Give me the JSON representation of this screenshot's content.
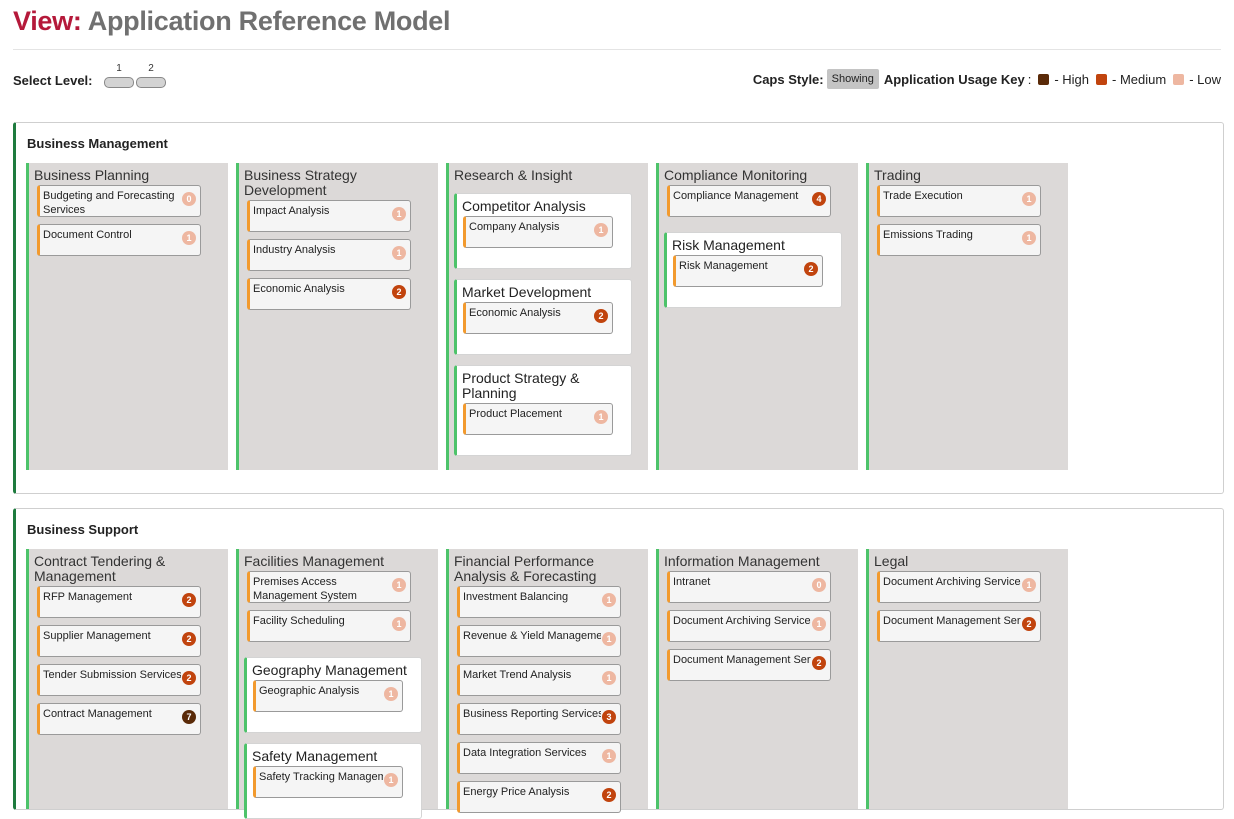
{
  "header": {
    "view_label": "View:",
    "title": "Application Reference Model"
  },
  "controls": {
    "select_level_label": "Select Level:",
    "levels": [
      "1",
      "2"
    ],
    "caps_style_label": "Caps Style:",
    "caps_style_value": "Showing",
    "usage_key_label": "Application Usage Key",
    "key": [
      {
        "label": "- High",
        "color": "#5a2a08"
      },
      {
        "label": "- Medium",
        "color": "#c1440e"
      },
      {
        "label": "- Low",
        "color": "#eeb7a1"
      }
    ]
  },
  "sections": [
    {
      "title": "Business Management",
      "columns": [
        {
          "title": "Business Planning",
          "apps": [
            {
              "name": "Budgeting and Forecasting Services",
              "count": "0"
            },
            {
              "name": "Document Control",
              "count": "1"
            }
          ]
        },
        {
          "title": "Business Strategy Development",
          "apps": [
            {
              "name": "Impact Analysis",
              "count": "1"
            },
            {
              "name": "Industry Analysis",
              "count": "1"
            },
            {
              "name": "Economic Analysis",
              "count": "2"
            }
          ]
        },
        {
          "title": "Research & Insight",
          "subs": [
            {
              "title": "Competitor Analysis",
              "apps": [
                {
                  "name": "Company Analysis",
                  "count": "1"
                }
              ]
            },
            {
              "title": "Market Development",
              "apps": [
                {
                  "name": "Economic Analysis",
                  "count": "2"
                }
              ]
            },
            {
              "title": "Product Strategy & Planning",
              "apps": [
                {
                  "name": "Product Placement",
                  "count": "1"
                }
              ]
            }
          ]
        },
        {
          "title": "Compliance Monitoring",
          "apps": [
            {
              "name": "Compliance Management",
              "count": "4"
            }
          ],
          "subs": [
            {
              "title": "Risk Management",
              "apps": [
                {
                  "name": "Risk Management",
                  "count": "2"
                }
              ]
            }
          ]
        },
        {
          "title": "Trading",
          "apps": [
            {
              "name": "Trade Execution",
              "count": "1"
            },
            {
              "name": "Emissions Trading",
              "count": "1"
            }
          ]
        }
      ]
    },
    {
      "title": "Business Support",
      "columns": [
        {
          "title": "Contract Tendering & Management",
          "apps": [
            {
              "name": "RFP Management",
              "count": "2"
            },
            {
              "name": "Supplier Management",
              "count": "2"
            },
            {
              "name": "Tender Submission Services",
              "count": "2"
            },
            {
              "name": "Contract Management",
              "count": "7"
            }
          ]
        },
        {
          "title": "Facilities Management",
          "apps": [
            {
              "name": "Premises Access Management System",
              "count": "1"
            },
            {
              "name": "Facility Scheduling",
              "count": "1"
            }
          ],
          "subs": [
            {
              "title": "Geography Management",
              "apps": [
                {
                  "name": "Geographic Analysis",
                  "count": "1"
                }
              ]
            },
            {
              "title": "Safety Management",
              "apps": [
                {
                  "name": "Safety Tracking Management",
                  "count": "1"
                }
              ]
            }
          ]
        },
        {
          "title": "Financial Performance Analysis & Forecasting",
          "apps": [
            {
              "name": "Investment Balancing",
              "count": "1"
            },
            {
              "name": "Revenue & Yield Management",
              "count": "1"
            },
            {
              "name": "Market Trend Analysis",
              "count": "1"
            },
            {
              "name": "Business Reporting Services",
              "count": "3"
            },
            {
              "name": "Data Integration Services",
              "count": "1"
            },
            {
              "name": "Energy Price Analysis",
              "count": "2"
            }
          ]
        },
        {
          "title": "Information Management",
          "apps": [
            {
              "name": "Intranet",
              "count": "0"
            },
            {
              "name": "Document Archiving Services",
              "count": "1"
            },
            {
              "name": "Document Management Services",
              "count": "2"
            }
          ]
        },
        {
          "title": "Legal",
          "apps": [
            {
              "name": "Document Archiving Services",
              "count": "1"
            },
            {
              "name": "Document Management Services",
              "count": "2"
            }
          ]
        }
      ]
    }
  ]
}
